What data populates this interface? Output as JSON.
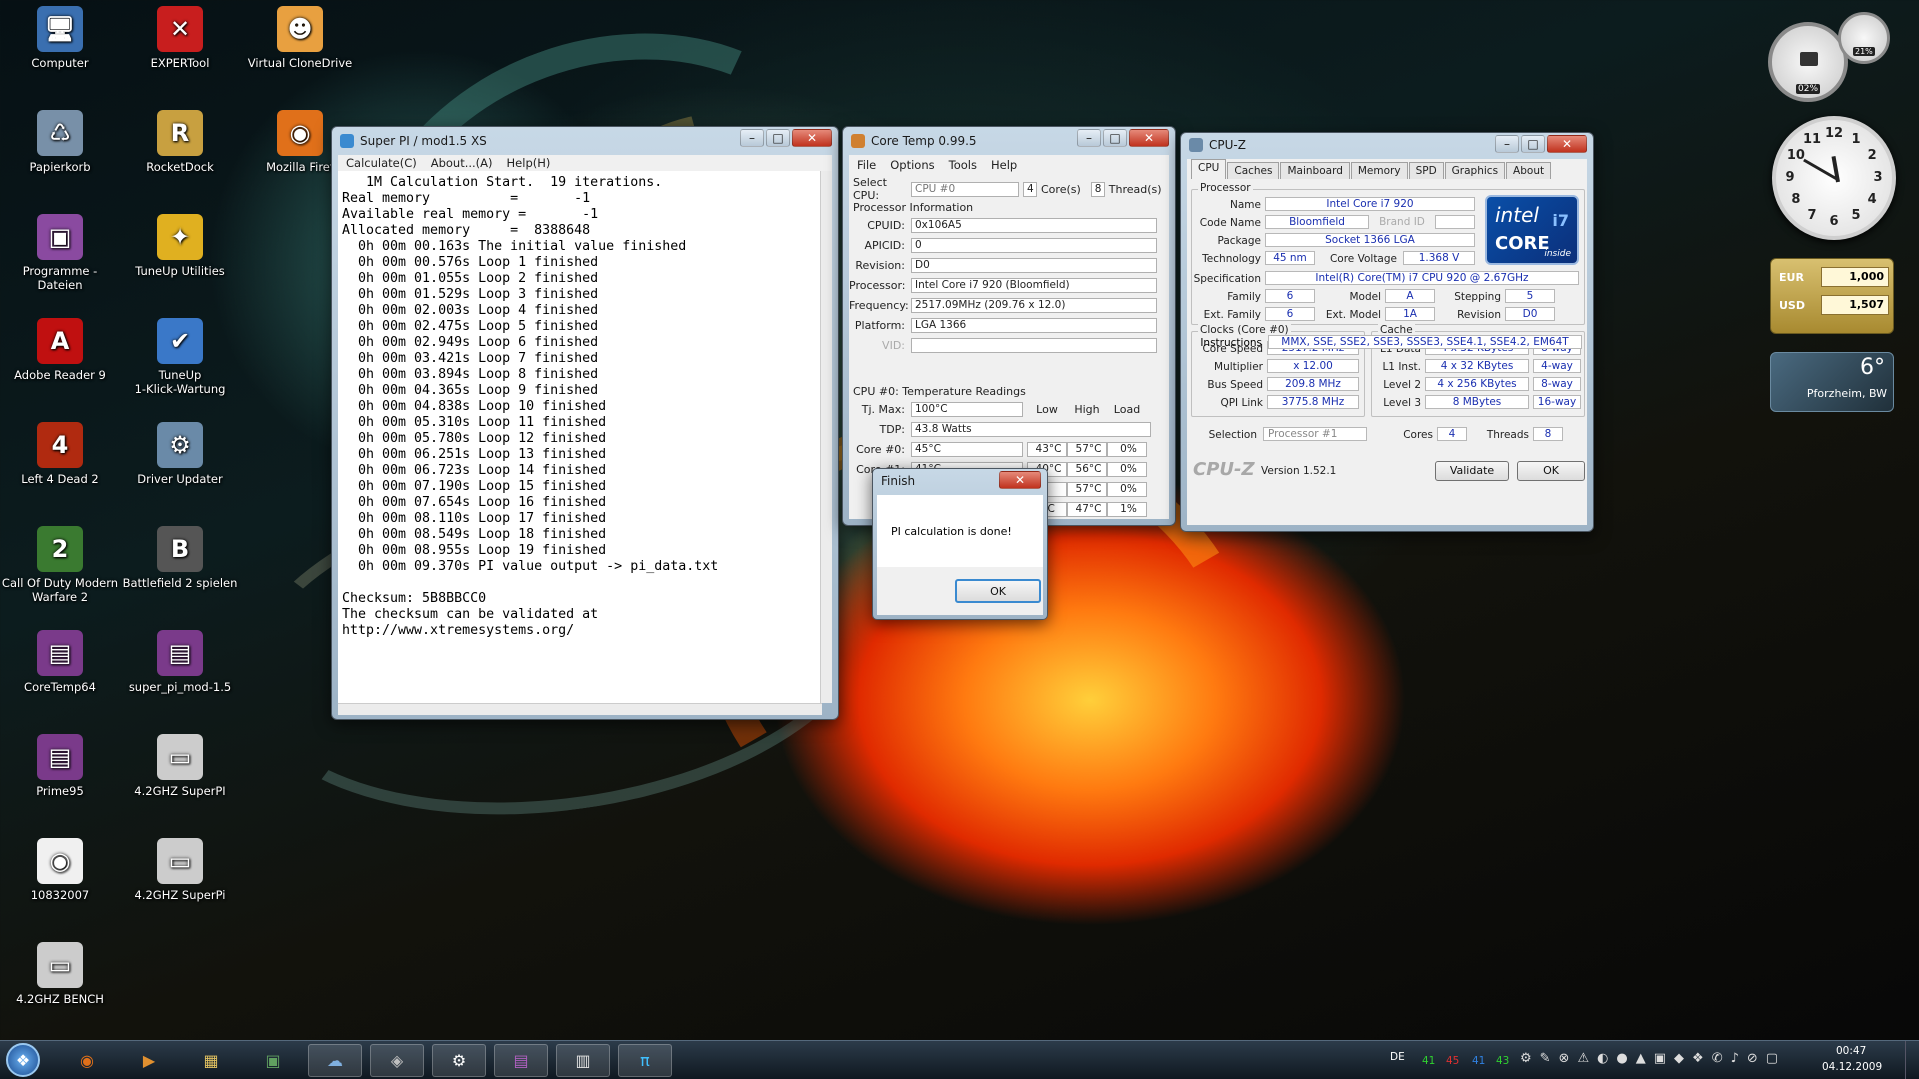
{
  "desktop": {
    "icons": [
      {
        "label": "Computer",
        "icon": "computer-icon",
        "color": "#3a6fb0",
        "glyph": "🖥"
      },
      {
        "label": "EXPERTool",
        "icon": "expertool-icon",
        "color": "#c81e1e",
        "glyph": "✕"
      },
      {
        "label": "Virtual CloneDrive",
        "icon": "clonedrive-icon",
        "color": "#e8a040",
        "glyph": "☻"
      },
      {
        "label": "Papierkorb",
        "icon": "recycle-bin-icon",
        "color": "#7890a8",
        "glyph": "♺"
      },
      {
        "label": "RocketDock",
        "icon": "rocketdock-icon",
        "color": "#c8a040",
        "glyph": "R"
      },
      {
        "label": "Mozilla Firef",
        "icon": "firefox-icon",
        "color": "#e0701a",
        "glyph": "◉"
      },
      {
        "label": "Programme - Dateien",
        "icon": "floppy-icon",
        "color": "#8a4aa0",
        "glyph": "▣"
      },
      {
        "label": "TuneUp Utilities",
        "icon": "tuneup-icon",
        "color": "#e0b020",
        "glyph": "✦"
      },
      {
        "label": "Adobe Reader 9",
        "icon": "adobe-reader-icon",
        "color": "#c01010",
        "glyph": "A"
      },
      {
        "label": "TuneUp\n1-Klick-Wartung",
        "icon": "tuneup-maintenance-icon",
        "color": "#3a78c8",
        "glyph": "✔"
      },
      {
        "label": "Left 4 Dead 2",
        "icon": "left4dead-icon",
        "color": "#b02a10",
        "glyph": "4"
      },
      {
        "label": "Driver Updater",
        "icon": "driver-updater-icon",
        "color": "#6a8aa8",
        "glyph": "⚙"
      },
      {
        "label": "Call Of Duty Modern\nWarfare 2",
        "icon": "cod-icon",
        "color": "#3a7a30",
        "glyph": "2"
      },
      {
        "label": "Battlefield 2 spielen",
        "icon": "battlefield-icon",
        "color": "#555555",
        "glyph": "B"
      },
      {
        "label": "CoreTemp64",
        "icon": "winrar-icon",
        "color": "#7a3a8a",
        "glyph": "▤"
      },
      {
        "label": "super_pi_mod-1.5",
        "icon": "winrar-icon",
        "color": "#7a3a8a",
        "glyph": "▤"
      },
      {
        "label": "Prime95",
        "icon": "winrar-icon",
        "color": "#7a3a8a",
        "glyph": "▤"
      },
      {
        "label": "4.2GHZ SuperPI",
        "icon": "image-icon",
        "color": "#cccccc",
        "glyph": "▭"
      },
      {
        "label": "10832007",
        "icon": "firefox-doc-icon",
        "color": "#f0f0f0",
        "glyph": "◉"
      },
      {
        "label": "4.2GHZ SuperPi",
        "icon": "image-icon",
        "color": "#cccccc",
        "glyph": "▭"
      },
      {
        "label": "4.2GHZ BENCH",
        "icon": "image-icon",
        "color": "#cccccc",
        "glyph": "▭"
      }
    ]
  },
  "superpi": {
    "title": "Super PI / mod1.5 XS",
    "menu": [
      "Calculate(C)",
      "About...(A)",
      "Help(H)"
    ],
    "output": "   1M Calculation Start.  19 iterations.\nReal memory          =       -1\nAvailable real memory =       -1\nAllocated memory     =  8388648\n  0h 00m 00.163s The initial value finished\n  0h 00m 00.576s Loop 1 finished\n  0h 00m 01.055s Loop 2 finished\n  0h 00m 01.529s Loop 3 finished\n  0h 00m 02.003s Loop 4 finished\n  0h 00m 02.475s Loop 5 finished\n  0h 00m 02.949s Loop 6 finished\n  0h 00m 03.421s Loop 7 finished\n  0h 00m 03.894s Loop 8 finished\n  0h 00m 04.365s Loop 9 finished\n  0h 00m 04.838s Loop 10 finished\n  0h 00m 05.310s Loop 11 finished\n  0h 00m 05.780s Loop 12 finished\n  0h 00m 06.251s Loop 13 finished\n  0h 00m 06.723s Loop 14 finished\n  0h 00m 07.190s Loop 15 finished\n  0h 00m 07.654s Loop 16 finished\n  0h 00m 08.110s Loop 17 finished\n  0h 00m 08.549s Loop 18 finished\n  0h 00m 08.955s Loop 19 finished\n  0h 00m 09.370s PI value output -> pi_data.txt\n\nChecksum: 5B8BBCC0\nThe checksum can be validated at\nhttp://www.xtremesystems.org/"
  },
  "coretemp": {
    "title": "Core Temp 0.99.5",
    "menu": [
      "File",
      "Options",
      "Tools",
      "Help"
    ],
    "select_cpu_label": "Select CPU:",
    "select_cpu_value": "CPU #0",
    "cores_count": "4",
    "cores_label": "Core(s)",
    "threads_count": "8",
    "threads_label": "Thread(s)",
    "proc_info_label": "Processor Information",
    "info": [
      {
        "label": "CPUID:",
        "value": "0x106A5"
      },
      {
        "label": "APICID:",
        "value": "0"
      },
      {
        "label": "Revision:",
        "value": "D0"
      },
      {
        "label": "Processor:",
        "value": "Intel Core i7 920 (Bloomfield)"
      },
      {
        "label": "Frequency:",
        "value": "2517.09MHz (209.76 x 12.0)"
      },
      {
        "label": "Platform:",
        "value": "LGA 1366"
      },
      {
        "label": "VID:",
        "value": ""
      }
    ],
    "temp_label": "CPU #0: Temperature Readings",
    "tjmax_label": "Tj. Max:",
    "tjmax": "100°C",
    "tdp_label": "TDP:",
    "tdp": "43.8 Watts",
    "col_low": "Low",
    "col_high": "High",
    "col_load": "Load",
    "cores": [
      {
        "label": "Core #0:",
        "value": "45°C",
        "low": "43°C",
        "high": "57°C",
        "load": "0%"
      },
      {
        "label": "Core #1:",
        "value": "41°C",
        "low": "40°C",
        "high": "56°C",
        "load": "0%"
      },
      {
        "label": "",
        "value": "",
        "low": "",
        "high": "57°C",
        "load": "0%"
      },
      {
        "label": "",
        "value": "",
        "low": "°C",
        "high": "47°C",
        "load": "1%"
      }
    ]
  },
  "dialog": {
    "title": "Finish",
    "message": "PI calculation is done!",
    "ok": "OK"
  },
  "cpuz": {
    "title": "CPU-Z",
    "tabs": [
      "CPU",
      "Caches",
      "Mainboard",
      "Memory",
      "SPD",
      "Graphics",
      "About"
    ],
    "processor_group": "Processor",
    "name_label": "Name",
    "name": "Intel Core i7 920",
    "codename_label": "Code Name",
    "codename": "Bloomfield",
    "brand_id_label": "Brand ID",
    "package_label": "Package",
    "package": "Socket 1366 LGA",
    "technology_label": "Technology",
    "technology": "45 nm",
    "core_voltage_label": "Core Voltage",
    "core_voltage": "1.368 V",
    "spec_label": "Specification",
    "spec": "Intel(R) Core(TM) i7 CPU      920  @ 2.67GHz",
    "family_label": "Family",
    "family": "6",
    "model_label": "Model",
    "model": "A",
    "stepping_label": "Stepping",
    "stepping": "5",
    "ext_family_label": "Ext. Family",
    "ext_family": "6",
    "ext_model_label": "Ext. Model",
    "ext_model": "1A",
    "revision_label": "Revision",
    "revision": "D0",
    "instructions_label": "Instructions",
    "instructions": "MMX, SSE, SSE2, SSE3, SSSE3, SSE4.1, SSE4.2, EM64T",
    "logo_top": "intel",
    "logo_mid": "CORE",
    "logo_i7": "i7",
    "logo_inside": "inside",
    "clocks_group": "Clocks (Core #0)",
    "core_speed_label": "Core Speed",
    "core_speed": "2517.2 MHz",
    "multiplier_label": "Multiplier",
    "multiplier": "x 12.00",
    "bus_speed_label": "Bus Speed",
    "bus_speed": "209.8 MHz",
    "qpi_label": "QPI Link",
    "qpi": "3775.8 MHz",
    "cache_group": "Cache",
    "l1d_label": "L1 Data",
    "l1d": "4 x 32 KBytes",
    "l1d_way": "8-way",
    "l1i_label": "L1 Inst.",
    "l1i": "4 x 32 KBytes",
    "l1i_way": "4-way",
    "l2_label": "Level 2",
    "l2": "4 x 256 KBytes",
    "l2_way": "8-way",
    "l3_label": "Level 3",
    "l3": "8 MBytes",
    "l3_way": "16-way",
    "selection_label": "Selection",
    "selection": "Processor #1",
    "cores_label": "Cores",
    "cores": "4",
    "threads_label": "Threads",
    "threads": "8",
    "brand": "CPU-Z",
    "version": "Version 1.52.1",
    "validate": "Validate",
    "ok": "OK"
  },
  "gadgets": {
    "meter_cpu": "02%",
    "meter_ram": "21%",
    "clock_numbers": [
      "12",
      "1",
      "2",
      "3",
      "4",
      "5",
      "6",
      "7",
      "8",
      "9",
      "10",
      "11"
    ],
    "eur_label": "EUR",
    "eur_value": "1,000",
    "usd_label": "USD",
    "usd_value": "1,507",
    "weather_temp": "6°",
    "weather_city": "Pforzheim, BW"
  },
  "taskbar": {
    "lang": "DE",
    "temps": [
      "41",
      "45",
      "41",
      "43"
    ],
    "temp_colors": [
      "#30d030",
      "#e03030",
      "#3080e0",
      "#30d030"
    ],
    "time": "00:47",
    "date": "04.12.2009",
    "apps": [
      {
        "name": "firefox-icon",
        "glyph": "◉",
        "color": "#e0701a"
      },
      {
        "name": "media-player-icon",
        "glyph": "▶",
        "color": "#e09030"
      },
      {
        "name": "explorer-icon",
        "glyph": "▦",
        "color": "#e0c060"
      },
      {
        "name": "monitor-icon",
        "glyph": "▣",
        "color": "#60a060"
      },
      {
        "name": "network-icon",
        "glyph": "☁",
        "color": "#80b0e0"
      },
      {
        "name": "drive-icon",
        "glyph": "◈",
        "color": "#c0c0c0"
      },
      {
        "name": "steam-icon",
        "glyph": "⚙",
        "color": "#ffffff"
      },
      {
        "name": "winrar-icon",
        "glyph": "▤",
        "color": "#b060c0"
      },
      {
        "name": "cputool-icon",
        "glyph": "▥",
        "color": "#e0e0e0"
      },
      {
        "name": "superpi-icon",
        "glyph": "π",
        "color": "#40c0ff"
      }
    ]
  }
}
